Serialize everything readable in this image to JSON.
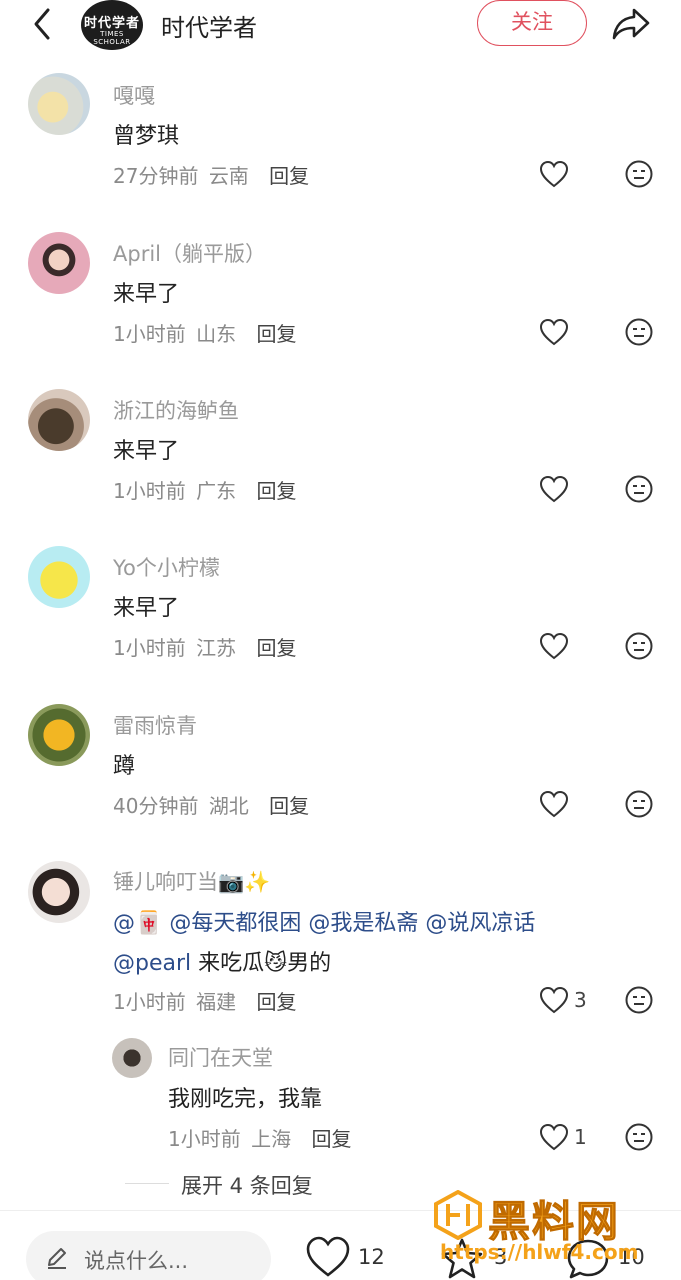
{
  "header": {
    "account_name": "时代学者",
    "logo_line1": "时代学者",
    "logo_line2": "TIMES SCHOLAR",
    "follow_label": "关注"
  },
  "comments": [
    {
      "user": "嘎嘎",
      "text": "曾梦琪",
      "time": "27分钟前",
      "location": "云南",
      "reply": "回复",
      "likes": ""
    },
    {
      "user": "April（躺平版）",
      "text": "来早了",
      "time": "1小时前",
      "location": "山东",
      "reply": "回复",
      "likes": ""
    },
    {
      "user": "浙江的海鲈鱼",
      "text": "来早了",
      "time": "1小时前",
      "location": "广东",
      "reply": "回复",
      "likes": ""
    },
    {
      "user": "Yo个小柠檬",
      "text": "来早了",
      "time": "1小时前",
      "location": "江苏",
      "reply": "回复",
      "likes": ""
    },
    {
      "user": "雷雨惊青",
      "text": "蹲",
      "time": "40分钟前",
      "location": "湖北",
      "reply": "回复",
      "likes": ""
    },
    {
      "user": "锤儿响叮当📷✨",
      "text_line1_parts": [
        "@",
        "🀄",
        " @每天都很困 @我是私斋 @说风凉话"
      ],
      "text_line2_parts": [
        "@pearl",
        " 来吃瓜",
        "😼",
        "男的"
      ],
      "time": "1小时前",
      "location": "福建",
      "reply": "回复",
      "likes": "3"
    }
  ],
  "sub_reply": {
    "user": "同门在天堂",
    "text": "我刚吃完，我靠",
    "time": "1小时前",
    "location": "上海",
    "reply": "回复",
    "likes": "1"
  },
  "expand_label": "展开 4 条回复",
  "bottom": {
    "placeholder": "说点什么...",
    "like_count": "12",
    "star_count": "3",
    "comment_count": "10"
  },
  "watermark": {
    "title": "黑料网",
    "url": "https://hlwf4.com"
  },
  "colors": {
    "accent": "#e0515f",
    "mention": "#2d4d8a",
    "watermark": "#f4a21a"
  }
}
